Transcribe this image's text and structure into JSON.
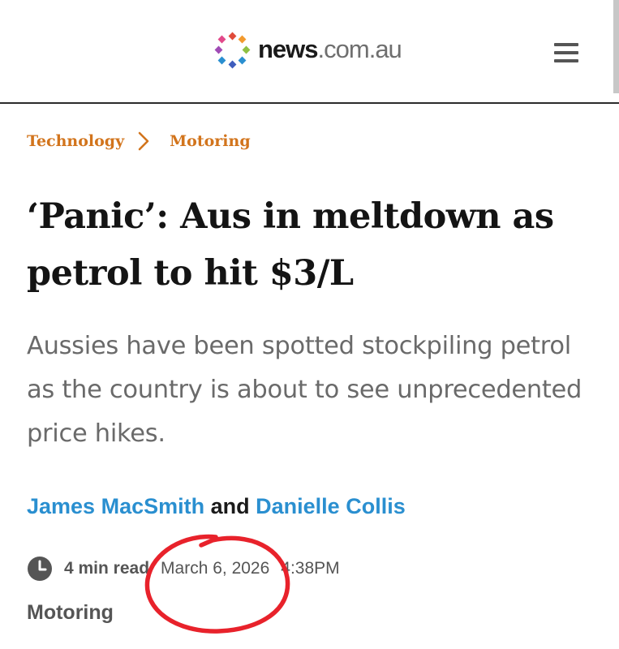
{
  "site": {
    "logo_name": "news",
    "logo_domain": ".com.au",
    "menu_icon": "hamburger-menu-icon",
    "logo_dot_colors": [
      "#e04b3a",
      "#f29a2e",
      "#8fc043",
      "#2a8fd0",
      "#3f5ebd",
      "#a04bb5",
      "#e2498a"
    ]
  },
  "breadcrumb": {
    "items": [
      "Technology",
      "Motoring"
    ],
    "separator_icon": "chevron-right-icon",
    "color": "#d2741c"
  },
  "article": {
    "headline": "‘Panic’: Aus in meltdown as petrol to hit $3/L",
    "standfirst": "Aussies have been spotted stockpiling petrol as the country is about to see unprecedented price hikes.",
    "byline": {
      "author_1": "James MacSmith",
      "connector": "and",
      "author_2": "Danielle Collis",
      "link_color": "#2a8fd0"
    },
    "meta": {
      "clock_icon": "clock-icon",
      "read_time": "4 min read",
      "date": "March 6, 2026",
      "time": "4:38PM"
    },
    "category": "Motoring"
  },
  "annotation": {
    "type": "hand-drawn circle",
    "color": "#e8222b"
  }
}
